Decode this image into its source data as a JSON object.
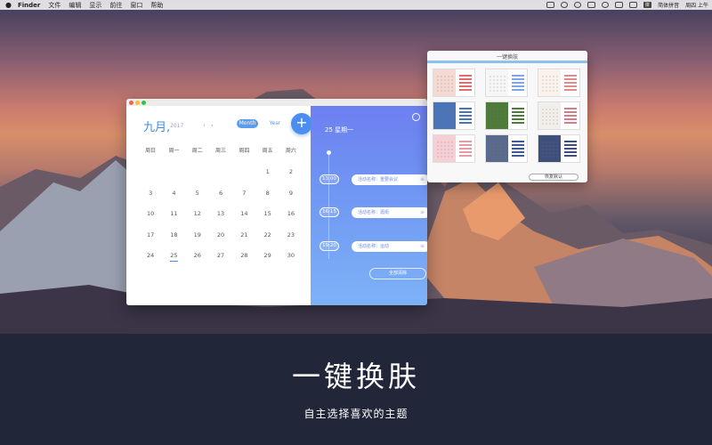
{
  "menubar": {
    "app_name": "Finder",
    "items": [
      "文件",
      "编辑",
      "显示",
      "前往",
      "窗口",
      "帮助"
    ],
    "ime_label": "简体拼音",
    "clock": "周四 上午"
  },
  "calendar": {
    "month": "九月,",
    "year": "2017",
    "nav": "‹ ›",
    "tab_month": "Month",
    "tab_year": "Year",
    "add": "+",
    "weekdays": [
      "周日",
      "周一",
      "周二",
      "周三",
      "周四",
      "周五",
      "周六"
    ],
    "days": [
      "",
      "",
      "",
      "",
      "",
      "1",
      "2",
      "3",
      "4",
      "5",
      "6",
      "7",
      "8",
      "9",
      "10",
      "11",
      "12",
      "13",
      "14",
      "15",
      "16",
      "17",
      "18",
      "19",
      "20",
      "21",
      "22",
      "23",
      "24",
      "25",
      "26",
      "27",
      "28",
      "29",
      "30"
    ],
    "selected_day": "25"
  },
  "schedule": {
    "date_header": "25 星期一",
    "events": [
      {
        "time": "13:00",
        "label": "活动名称：重要会议",
        "edit": "≡"
      },
      {
        "time": "16:15",
        "label": "活动名称：逛街",
        "edit": "≡"
      },
      {
        "time": "19:20",
        "label": "活动名称：运动",
        "edit": "≡"
      }
    ],
    "clear_all": "全部清除"
  },
  "skin_picker": {
    "title": "一键换肤",
    "restore": "恢复默认",
    "skins": [
      {
        "left": "#f3d9d2",
        "right": "#ffffff",
        "bar": "#e26b6b"
      },
      {
        "left": "#f6f6f6",
        "right": "#ffffff",
        "bar": "#7da7e8"
      },
      {
        "left": "#fbf2ec",
        "right": "#ffffff",
        "bar": "#e08a8a"
      },
      {
        "left": "#4a74b8",
        "right": "#ffffff",
        "bar": "#4a74b8"
      },
      {
        "left": "#4e7a3a",
        "right": "#ffffff",
        "bar": "#4e7a3a"
      },
      {
        "left": "#f2eeea",
        "right": "#ffffff",
        "bar": "#d47d86"
      },
      {
        "left": "#f6cfd4",
        "right": "#ffffff",
        "bar": "#e79aa6"
      },
      {
        "left": "#5a6a8c",
        "right": "#ffffff",
        "bar": "#3d5a96"
      },
      {
        "left": "#3d4f7a",
        "right": "#ffffff",
        "bar": "#3d4f7a"
      }
    ]
  },
  "caption": {
    "title": "一键换肤",
    "subtitle": "自主选择喜欢的主题"
  }
}
